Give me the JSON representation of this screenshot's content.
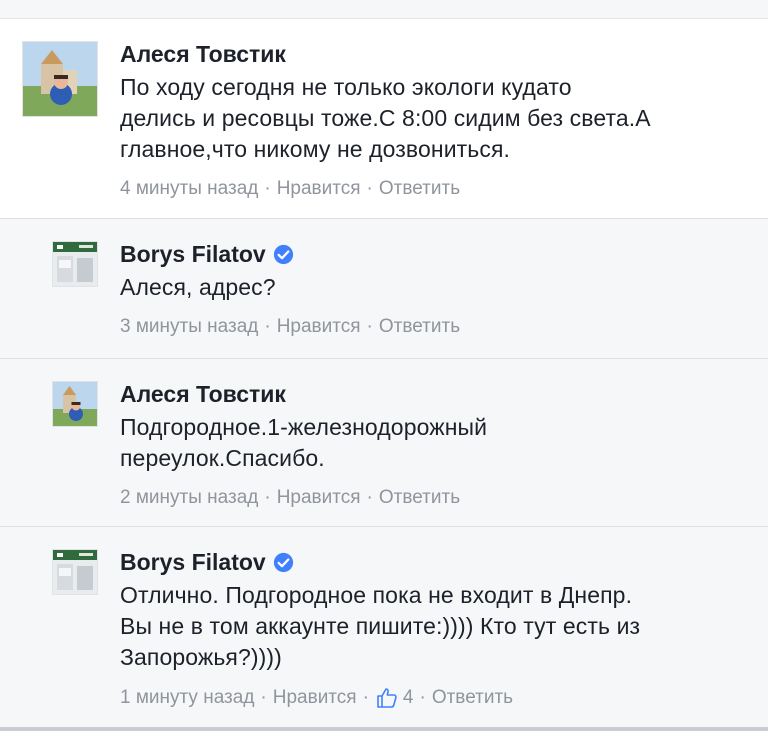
{
  "comments": [
    {
      "author": "Алеся Товстик",
      "verified": false,
      "text_lines": [
        "По ходу сегодня не только экологи кудато",
        "делись и ресовцы тоже.С 8:00 сидим без света.А",
        "главное,что никому не дозвониться."
      ],
      "time": "4 минуты назад",
      "like_label": "Нравится",
      "reply_label": "Ответить",
      "separator": "·"
    },
    {
      "author": "Borys Filatov",
      "verified": true,
      "text_lines": [
        "Алеся, адрес?"
      ],
      "time": "3 минуты назад",
      "like_label": "Нравится",
      "reply_label": "Ответить",
      "separator": "·"
    },
    {
      "author": "Алеся Товстик",
      "verified": false,
      "text_lines": [
        "Подгородное.1-железнодорожный",
        "переулок.Спасибо."
      ],
      "time": "2 минуты назад",
      "like_label": "Нравится",
      "reply_label": "Ответить",
      "separator": "·"
    },
    {
      "author": "Borys Filatov",
      "verified": true,
      "text_lines": [
        "Отлично. Подгородное пока не входит в Днепр.",
        "Вы не в том аккаунте пишите:)))) Кто тут есть из",
        "Запорожья?))))"
      ],
      "time": "1 минуту назад",
      "like_label": "Нравится",
      "like_count": "4",
      "reply_label": "Ответить",
      "separator": "·"
    }
  ],
  "colors": {
    "name": "#1d2129",
    "meta": "#90949c",
    "verified": "#4080ff",
    "background": "#f6f7f9"
  },
  "icons": [
    "verified-badge-icon",
    "thumbs-up-icon"
  ]
}
